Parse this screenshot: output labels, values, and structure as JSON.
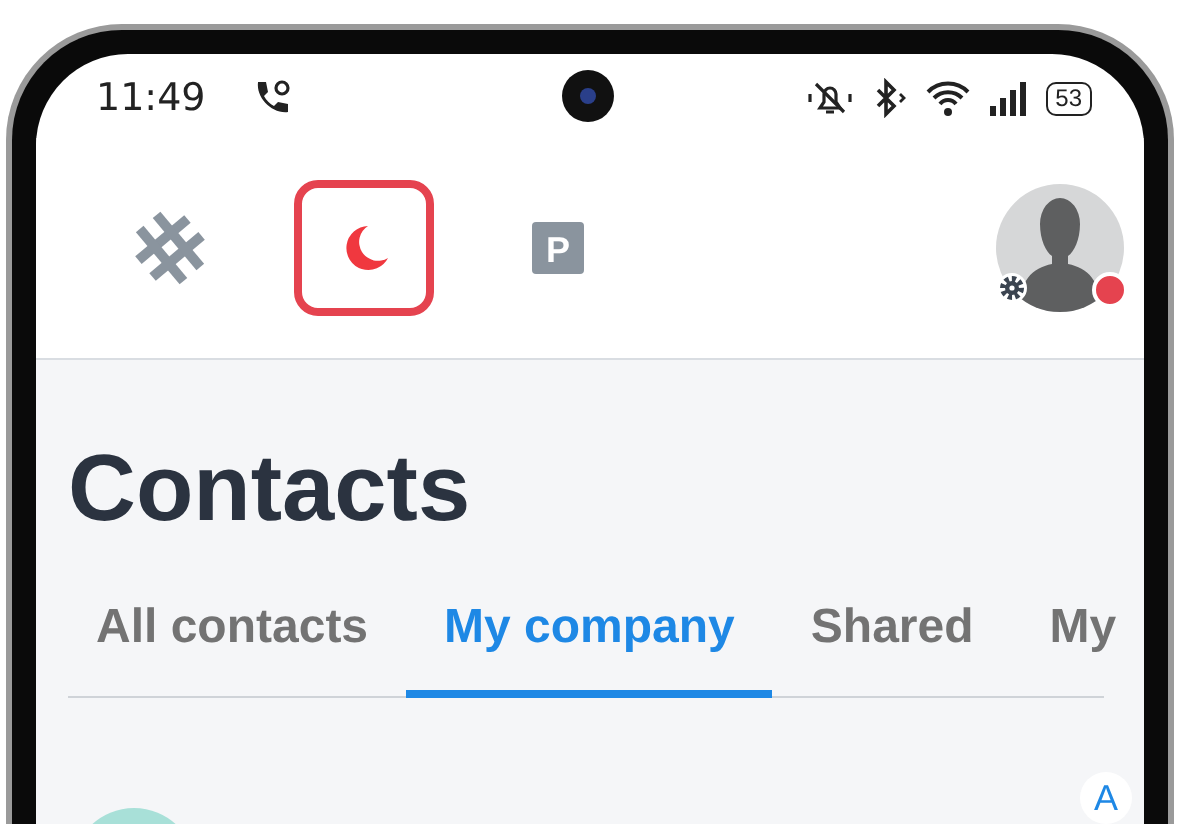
{
  "status_bar": {
    "time": "11:49",
    "battery": "53"
  },
  "toolbar": {
    "items": [
      {
        "kind": "logo",
        "selected": false
      },
      {
        "kind": "moon",
        "selected": true
      },
      {
        "kind": "parking",
        "selected": false,
        "label": "P"
      }
    ],
    "avatar": {
      "busy": true
    }
  },
  "title": "Contacts",
  "tabs": [
    {
      "label": "All contacts",
      "selected": false
    },
    {
      "label": "My company",
      "selected": true
    },
    {
      "label": "Shared",
      "selected": false
    },
    {
      "label": "My",
      "selected": false
    }
  ],
  "index_letter": "A"
}
